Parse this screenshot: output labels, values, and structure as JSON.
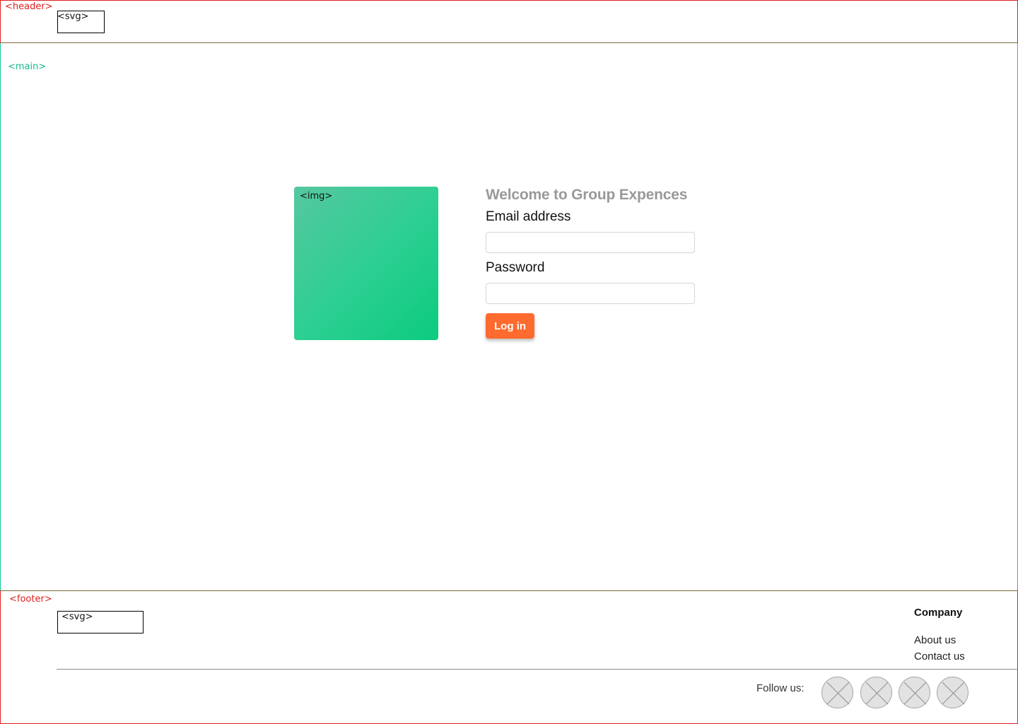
{
  "header": {
    "tag_label": "<header>",
    "logo_label": "<svg>"
  },
  "main": {
    "tag_label": "<main>",
    "image_label": "<img>",
    "title": "Welcome to Group Expences",
    "email_label": "Email address",
    "email_value": "",
    "password_label": "Password",
    "password_value": "",
    "login_button_label": "Log in"
  },
  "footer": {
    "tag_label": "<footer>",
    "logo_label": "<svg>",
    "company_heading": "Company",
    "links": [
      "About us",
      "Contact us"
    ],
    "follow_label": "Follow us:",
    "social_icons": [
      "social-icon-1",
      "social-icon-2",
      "social-icon-3",
      "social-icon-4"
    ]
  },
  "colors": {
    "header_border": "#e0201f",
    "main_border": "#17c79a",
    "accent_button": "#ff6a2f",
    "image_gradient_start": "#57c7a0",
    "image_gradient_end": "#0ccb7f"
  }
}
